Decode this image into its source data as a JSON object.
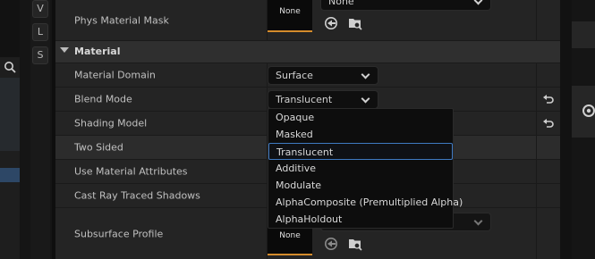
{
  "left": {
    "toolbar_letters": [
      "V",
      "L",
      "S"
    ]
  },
  "phys_material_mask": {
    "label": "Phys Material Mask",
    "thumbnail_text": "None",
    "combo_value": "None"
  },
  "section": {
    "title": "Material"
  },
  "rows": {
    "material_domain": {
      "label": "Material Domain",
      "value": "Surface"
    },
    "blend_mode": {
      "label": "Blend Mode",
      "value": "Translucent"
    },
    "shading_model": {
      "label": "Shading Model"
    },
    "two_sided": {
      "label": "Two Sided"
    },
    "use_material_attributes": {
      "label": "Use Material Attributes"
    },
    "cast_ray_traced_shadows": {
      "label": "Cast Ray Traced Shadows"
    },
    "subsurface_profile": {
      "label": "Subsurface Profile",
      "thumbnail_text": "None"
    }
  },
  "dropdown": {
    "items": [
      "Opaque",
      "Masked",
      "Translucent",
      "Additive",
      "Modulate",
      "AlphaComposite (Premultiplied Alpha)",
      "AlphaHoldout"
    ],
    "selected": "Translucent"
  },
  "colors": {
    "accent_orange": "#d58c2c",
    "selection_blue": "#3f7ac2",
    "row_bg": "#242424",
    "header_bg": "#2f2f2f"
  }
}
